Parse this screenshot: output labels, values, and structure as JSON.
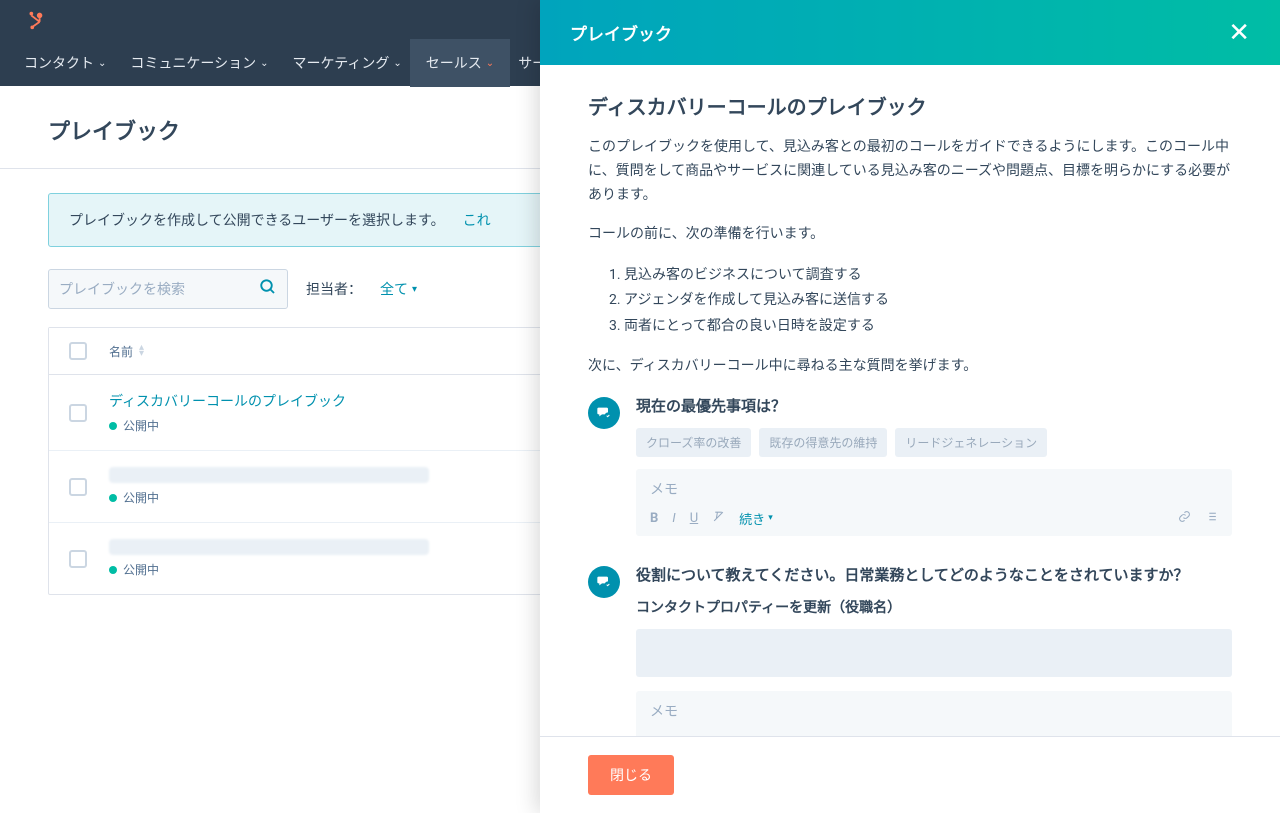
{
  "nav": {
    "items": [
      "コンタクト",
      "コミュニケーション",
      "マーケティング",
      "セールス",
      "サービス"
    ]
  },
  "page": {
    "title": "プレイブック"
  },
  "alert": {
    "text": "プレイブックを作成して公開できるユーザーを選択します。",
    "link": "これ"
  },
  "search": {
    "placeholder": "プレイブックを検索"
  },
  "filter": {
    "label": "担当者：",
    "value": "全て"
  },
  "table": {
    "header_name": "名前",
    "rows": [
      {
        "title": "ディスカバリーコールのプレイブック",
        "status": "公開中",
        "redacted": false
      },
      {
        "title": "",
        "status": "公開中",
        "redacted": true
      },
      {
        "title": "",
        "status": "公開中",
        "redacted": true
      }
    ]
  },
  "panel": {
    "header": "プレイブック",
    "title": "ディスカバリーコールのプレイブック",
    "intro": "このプレイブックを使用して、見込み客との最初のコールをガイドできるようにします。このコール中に、質問をして商品やサービスに関連している見込み客のニーズや問題点、目標を明らかにする必要があります。",
    "prep_title": "コールの前に、次の準備を行います。",
    "prep_items": [
      "見込み客のビジネスについて調査する",
      "アジェンダを作成して見込み客に送信する",
      "両者にとって都合の良い日時を設定する"
    ],
    "next_title": "次に、ディスカバリーコール中に尋ねる主な質問を挙げます。",
    "q1": {
      "title": "現在の最優先事項は？",
      "chips": [
        "クローズ率の改善",
        "既存の得意先の維持",
        "リードジェネレーション"
      ],
      "memo_placeholder": "メモ",
      "more": "続き"
    },
    "q2": {
      "title": "役割について教えてください。日常業務としてどのようなことをされていますか？",
      "sub": "コンタクトプロパティーを更新（役職名）",
      "memo_placeholder": "メモ"
    },
    "close_btn": "閉じる"
  }
}
